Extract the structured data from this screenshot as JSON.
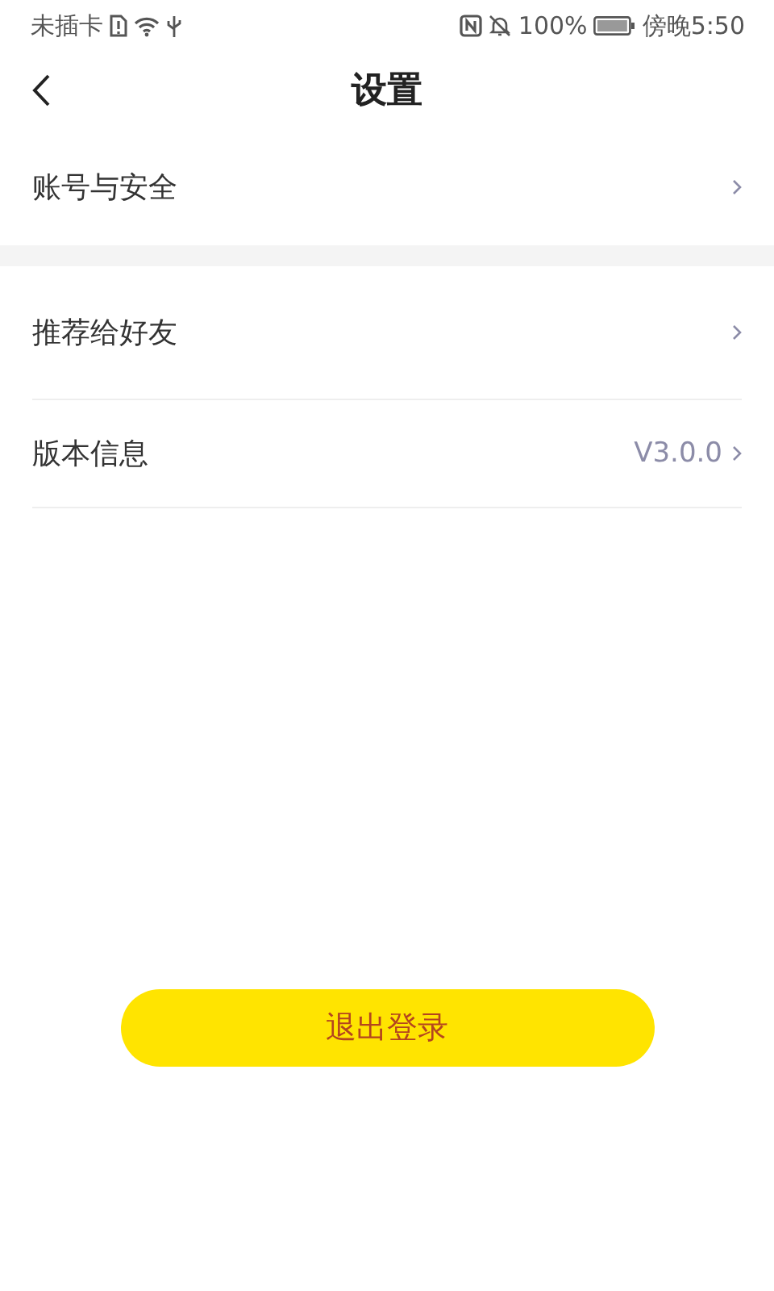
{
  "status_bar": {
    "carrier": "未插卡",
    "battery": "100%",
    "time": "傍晚5:50"
  },
  "header": {
    "title": "设置"
  },
  "groups": [
    {
      "kind": "plain",
      "items": [
        {
          "label": "账号与安全"
        }
      ]
    },
    {
      "kind": "divided",
      "items": [
        {
          "label": "推荐给好友"
        },
        {
          "label": "版本信息",
          "value": "V3.0.0"
        }
      ]
    }
  ],
  "logout_button": "退出登录"
}
